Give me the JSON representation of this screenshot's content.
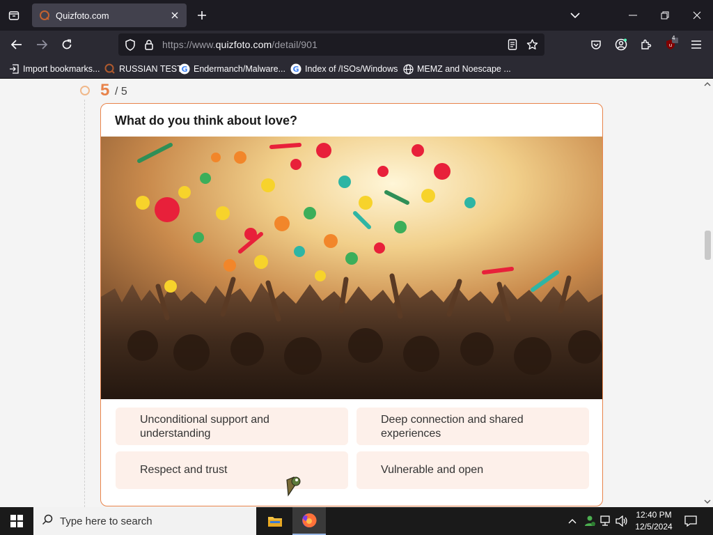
{
  "browser": {
    "tab_title": "Quizfoto.com",
    "url_prefix": "https://www.",
    "url_host": "quizfoto.com",
    "url_path": "/detail/901",
    "extension_badge": "4"
  },
  "bookmarks": [
    {
      "label": "Import bookmarks...",
      "icon": "import-icon"
    },
    {
      "label": "RUSSIAN TEST",
      "icon": "site-favicon"
    },
    {
      "label": "Endermanch/Malware...",
      "icon": "google-icon"
    },
    {
      "label": "Index of /ISOs/Windows",
      "icon": "google-icon"
    },
    {
      "label": "MEMZ and Noescape ...",
      "icon": "globe-icon"
    }
  ],
  "quiz": {
    "step_current": "5",
    "step_total": "/ 5",
    "question": "What do you think about love?",
    "answers": [
      {
        "lines": [
          "Unconditional support and",
          "understanding"
        ]
      },
      {
        "lines": [
          "Deep connection and shared",
          "experiences"
        ]
      },
      {
        "lines": [
          "Respect and trust"
        ]
      },
      {
        "lines": [
          "Vulnerable and open"
        ]
      }
    ]
  },
  "taskbar": {
    "search_placeholder": "Type here to search",
    "time": "12:40 PM",
    "date": "12/5/2024"
  },
  "colors": {
    "accent": "#e8834a",
    "answer_bg": "#fdf0ea",
    "browser_dark": "#1c1b22",
    "browser_toolbar": "#2b2a33"
  }
}
